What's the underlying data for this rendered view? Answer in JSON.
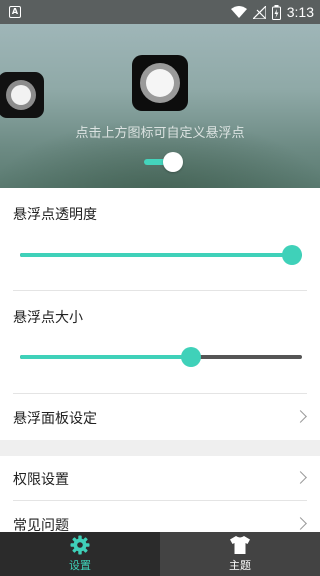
{
  "status_bar": {
    "time": "3:13",
    "app_icon_letter": "A",
    "icons": [
      "wifi-icon",
      "signal-off-icon",
      "battery-charging-icon"
    ]
  },
  "header": {
    "hint": "点击上方图标可自定义悬浮点",
    "toggle_on": true
  },
  "settings": {
    "opacity": {
      "label": "悬浮点透明度",
      "value_percent": 100
    },
    "size": {
      "label": "悬浮点大小",
      "value_percent": 62
    },
    "panel": {
      "label": "悬浮面板设定"
    },
    "permissions": {
      "label": "权限设置"
    },
    "faq": {
      "label": "常见问题"
    }
  },
  "bottom_nav": {
    "tabs": [
      {
        "label": "设置",
        "icon": "gear-icon",
        "active": true
      },
      {
        "label": "主题",
        "icon": "tshirt-icon",
        "active": false
      }
    ]
  },
  "colors": {
    "accent": "#3fd1b9",
    "nav_bg": "#2f2f2f"
  }
}
